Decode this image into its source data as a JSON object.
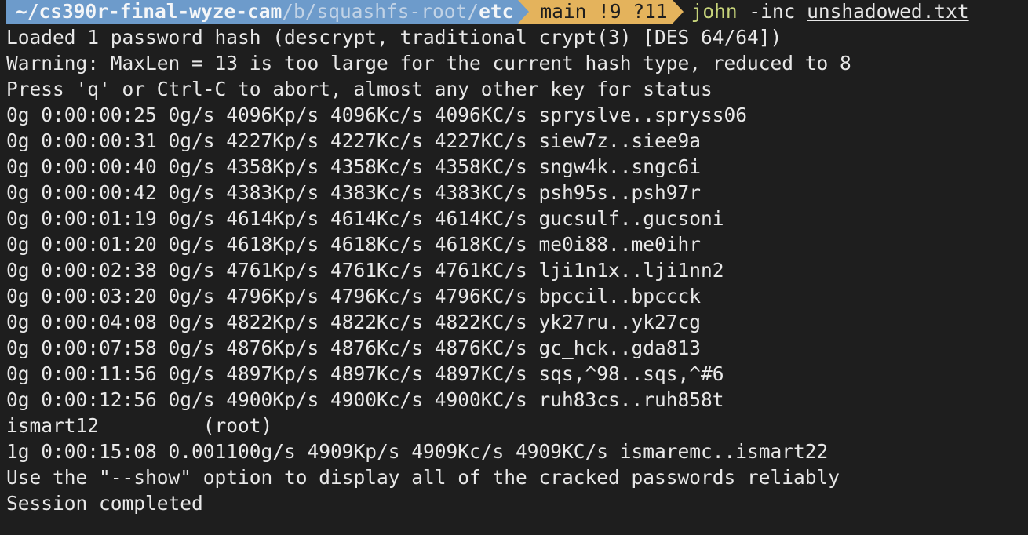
{
  "prompt": {
    "path_home": "~/cs390r-final-wyze-cam",
    "path_sep1": "/",
    "path_dim": "b",
    "path_sep2": "/squashfs-root/",
    "path_current": "etc",
    "git_status": "main !9 ?11",
    "command_program": "john",
    "command_args": " -inc ",
    "command_file": "unshadowed.txt"
  },
  "colors": {
    "background": "#1e1e1e",
    "path_segment": "#6d9bcb",
    "git_segment": "#e4b35c",
    "command_green": "#c6d37a",
    "text": "#e8e8e8"
  },
  "output": [
    "Loaded 1 password hash (descrypt, traditional crypt(3) [DES 64/64])",
    "Warning: MaxLen = 13 is too large for the current hash type, reduced to 8",
    "Press 'q' or Ctrl-C to abort, almost any other key for status",
    "0g 0:00:00:25 0g/s 4096Kp/s 4096Kc/s 4096KC/s spryslve..spryss06",
    "0g 0:00:00:31 0g/s 4227Kp/s 4227Kc/s 4227KC/s siew7z..siee9a",
    "0g 0:00:00:40 0g/s 4358Kp/s 4358Kc/s 4358KC/s sngw4k..sngc6i",
    "0g 0:00:00:42 0g/s 4383Kp/s 4383Kc/s 4383KC/s psh95s..psh97r",
    "0g 0:00:01:19 0g/s 4614Kp/s 4614Kc/s 4614KC/s gucsulf..gucsoni",
    "0g 0:00:01:20 0g/s 4618Kp/s 4618Kc/s 4618KC/s me0i88..me0ihr",
    "0g 0:00:02:38 0g/s 4761Kp/s 4761Kc/s 4761KC/s lji1n1x..lji1nn2",
    "0g 0:00:03:20 0g/s 4796Kp/s 4796Kc/s 4796KC/s bpccil..bpccck",
    "0g 0:00:04:08 0g/s 4822Kp/s 4822Kc/s 4822KC/s yk27ru..yk27cg",
    "0g 0:00:07:58 0g/s 4876Kp/s 4876Kc/s 4876KC/s gc_hck..gda813",
    "0g 0:00:11:56 0g/s 4897Kp/s 4897Kc/s 4897KC/s sqs,^98..sqs,^#6",
    "0g 0:00:12:56 0g/s 4900Kp/s 4900Kc/s 4900KC/s ruh83cs..ruh858t",
    "ismart12         (root)",
    "1g 0:00:15:08 0.001100g/s 4909Kp/s 4909Kc/s 4909KC/s ismaremc..ismart22",
    "Use the \"--show\" option to display all of the cracked passwords reliably",
    "Session completed"
  ]
}
